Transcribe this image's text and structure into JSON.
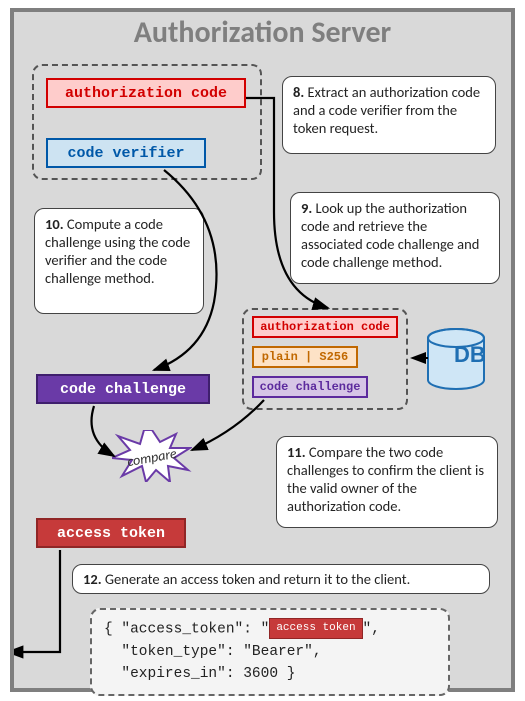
{
  "header": {
    "title": "Authorization Server"
  },
  "group1": {
    "auth_code_label": "authorization code",
    "verifier_label": "code verifier"
  },
  "callouts": {
    "c8": {
      "num": "8.",
      "text": "Extract an authorization code and a code verifier from the token request."
    },
    "c9": {
      "num": "9.",
      "text": "Look up the authorization code and retrieve the associated code challenge and code challenge method."
    },
    "c10": {
      "num": "10.",
      "text": "Compute a code challenge using the code verifier and the code challenge method."
    },
    "c11": {
      "num": "11.",
      "text": "Compare the two code challenges to confirm the client is the valid owner of the authorization code."
    },
    "c12": {
      "num": "12.",
      "text": "Generate an access token and return it to the client."
    }
  },
  "group2": {
    "auth_code_label": "authorization code",
    "method_label": "plain | S256",
    "challenge_label": "code challenge"
  },
  "computed_challenge_label": "code challenge",
  "compare_label": "compare",
  "db_label": "DB",
  "access_token_label": "access token",
  "json": {
    "line1a": "{ \"access_token\": \"",
    "token_chip": "access token",
    "line1b": "\",",
    "line2": "  \"token_type\": \"Bearer\",",
    "line3": "  \"expires_in\": 3600 }"
  }
}
